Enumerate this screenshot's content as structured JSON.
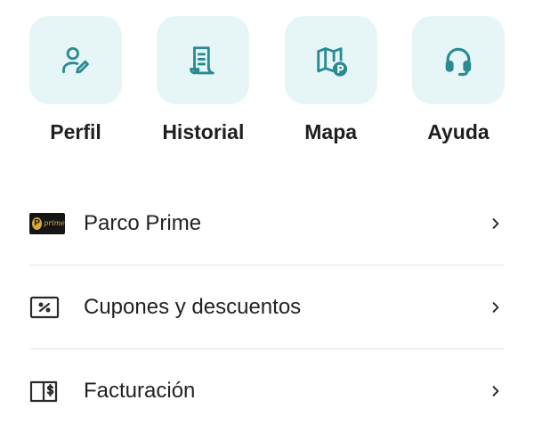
{
  "colors": {
    "accent": "#2a8a93",
    "tile_bg": "#e6f6f7",
    "prime_gold": "#d7a93c"
  },
  "shortcuts": [
    {
      "label": "Perfil",
      "icon": "user-edit-icon"
    },
    {
      "label": "Historial",
      "icon": "receipt-icon"
    },
    {
      "label": "Mapa",
      "icon": "map-parking-icon"
    },
    {
      "label": "Ayuda",
      "icon": "headset-icon"
    }
  ],
  "menu": {
    "items": [
      {
        "label": "Parco Prime",
        "icon": "parco-prime-badge",
        "badge_letter": "P",
        "badge_text": "prime"
      },
      {
        "label": "Cupones y descuentos",
        "icon": "coupon-percent-icon"
      },
      {
        "label": "Facturación",
        "icon": "invoice-icon"
      }
    ]
  }
}
